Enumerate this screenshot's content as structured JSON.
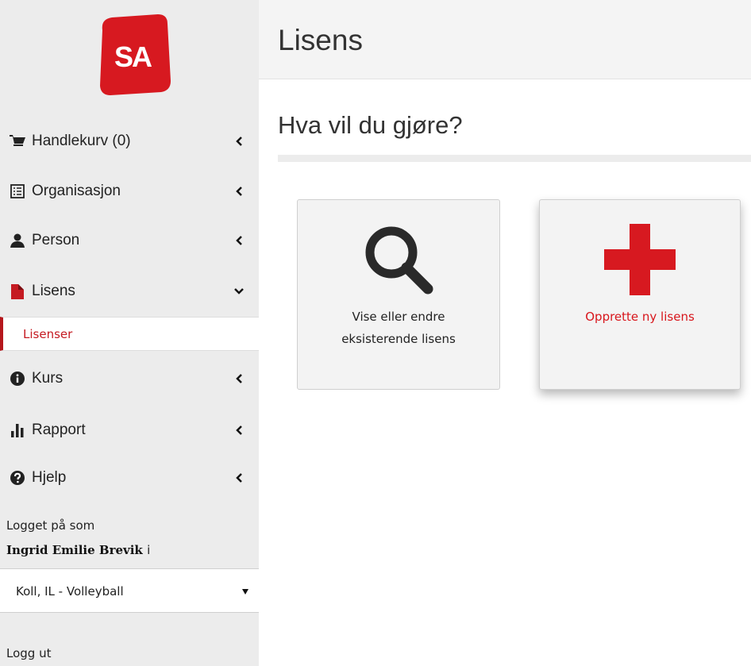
{
  "brand": {
    "logo_text": "SA",
    "color": "#d71920"
  },
  "sidebar": {
    "items": [
      {
        "label": "Handlekurv (0)",
        "icon": "cart-icon",
        "state": "collapsed"
      },
      {
        "label": "Organisasjon",
        "icon": "list-icon",
        "state": "collapsed"
      },
      {
        "label": "Person",
        "icon": "user-icon",
        "state": "collapsed"
      },
      {
        "label": "Lisens",
        "icon": "file-icon",
        "state": "expanded"
      },
      {
        "label": "Kurs",
        "icon": "info-icon",
        "state": "collapsed"
      },
      {
        "label": "Rapport",
        "icon": "bar-chart-icon",
        "state": "collapsed"
      },
      {
        "label": "Hjelp",
        "icon": "question-icon",
        "state": "collapsed"
      }
    ],
    "subitem": {
      "label": "Lisenser",
      "active": true
    },
    "logged_in_label": "Logget på som",
    "user_name": "Ingrid Emilie Brevik",
    "user_info_glyph": "i",
    "org_select": {
      "selected": "Koll, IL - Volleyball"
    },
    "logout_label": "Logg ut"
  },
  "main": {
    "title": "Lisens",
    "question": "Hva vil du gjøre?",
    "cards": [
      {
        "label_line1": "Vise eller endre",
        "label_line2": "eksisterende lisens",
        "icon": "search-icon"
      },
      {
        "label": "Opprette ny lisens",
        "icon": "plus-icon"
      }
    ]
  },
  "colors": {
    "accent": "#d71920",
    "active_border": "#b5171c",
    "sidebar_bg": "#ececec"
  }
}
